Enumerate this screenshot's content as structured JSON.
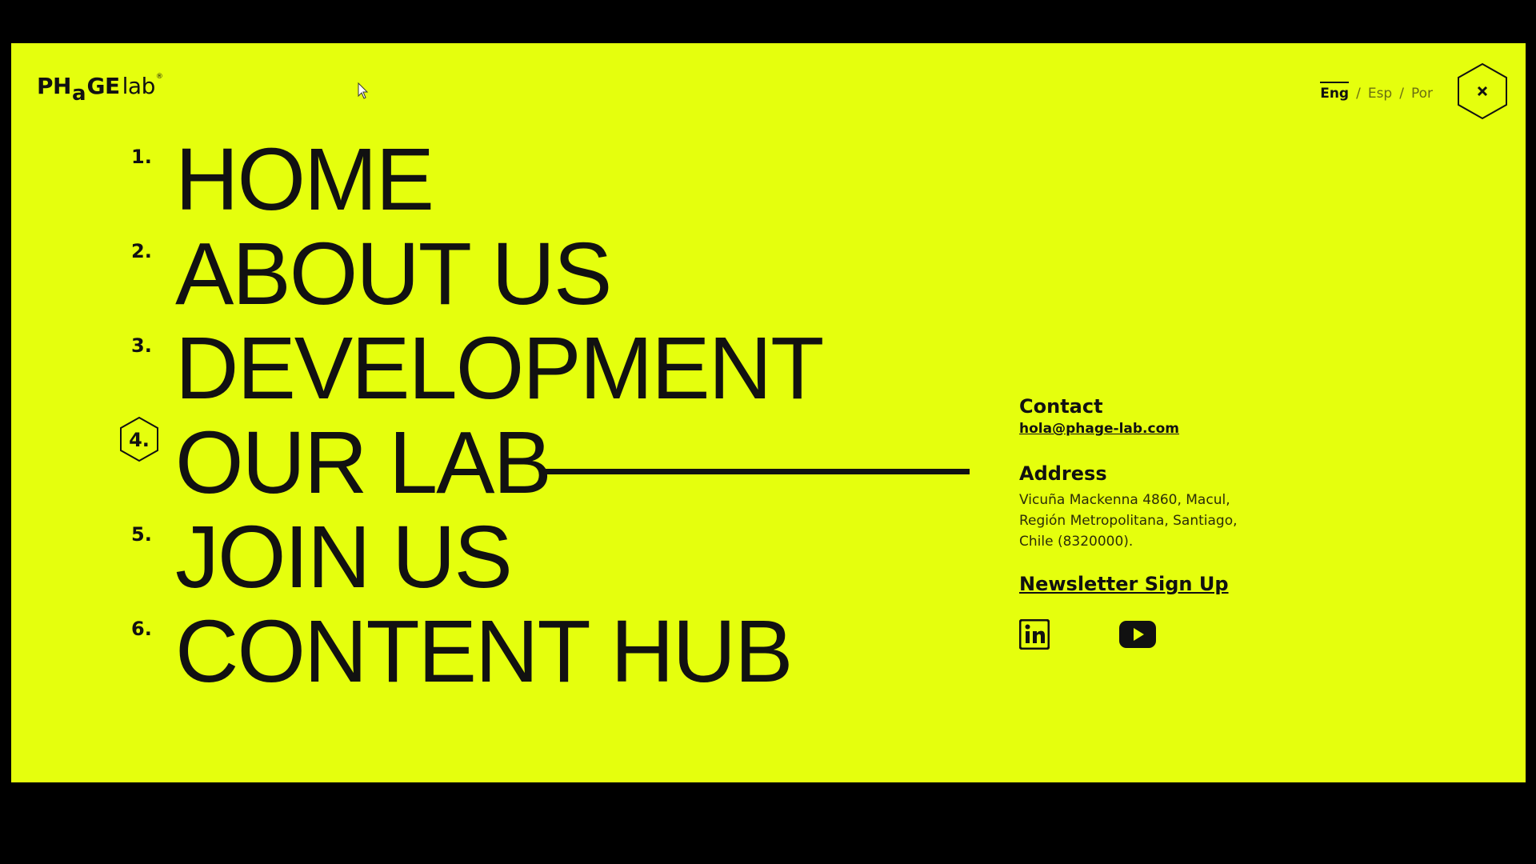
{
  "logo": {
    "part1": "PH",
    "part2": "a",
    "part3": "GE",
    "part4": "lab",
    "mark": "®"
  },
  "languages": {
    "items": [
      "Eng",
      "Esp",
      "Por"
    ],
    "active": "Eng",
    "separator": "/"
  },
  "close_button": {
    "icon": "close-icon",
    "label": "×"
  },
  "nav": {
    "items": [
      {
        "number": "1.",
        "label": "HOME"
      },
      {
        "number": "2.",
        "label": "ABOUT US"
      },
      {
        "number": "3.",
        "label": "DEVELOPMENT"
      },
      {
        "number": "4.",
        "label": "OUR LAB",
        "active": true
      },
      {
        "number": "5.",
        "label": "JOIN US"
      },
      {
        "number": "6.",
        "label": "CONTENT HUB"
      }
    ]
  },
  "contact": {
    "title": "Contact",
    "email": "hola@phage-lab.com"
  },
  "address": {
    "title": "Address",
    "lines": [
      "Vicuña Mackenna 4860, Macul,",
      "Región Metropolitana, Santiago,",
      "Chile (8320000)."
    ]
  },
  "newsletter": {
    "label": "Newsletter Sign Up"
  },
  "social": {
    "items": [
      {
        "name": "linkedin",
        "icon": "linkedin-icon"
      },
      {
        "name": "youtube",
        "icon": "youtube-icon"
      }
    ]
  },
  "colors": {
    "background": "#e5ff0d",
    "ink": "#111111",
    "frame": "#000000"
  }
}
